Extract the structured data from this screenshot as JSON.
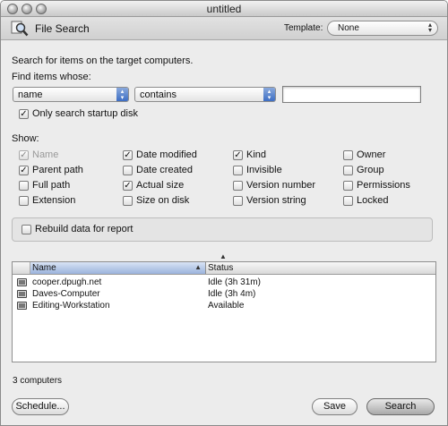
{
  "window": {
    "title": "untitled"
  },
  "toolbar": {
    "title": "File Search",
    "template_label": "Template:",
    "template_value": "None"
  },
  "search": {
    "intro": "Search for items on the target computers.",
    "find_label": "Find items whose:",
    "attribute": "name",
    "operator": "contains",
    "query": "",
    "startup_disk": {
      "label": "Only search startup disk",
      "checked": true
    }
  },
  "show": {
    "label": "Show:",
    "columns": [
      [
        {
          "label": "Name",
          "checked": true,
          "disabled": true
        },
        {
          "label": "Parent path",
          "checked": true
        },
        {
          "label": "Full path",
          "checked": false
        },
        {
          "label": "Extension",
          "checked": false
        }
      ],
      [
        {
          "label": "Date modified",
          "checked": true
        },
        {
          "label": "Date created",
          "checked": false
        },
        {
          "label": "Actual size",
          "checked": true
        },
        {
          "label": "Size on disk",
          "checked": false
        }
      ],
      [
        {
          "label": "Kind",
          "checked": true
        },
        {
          "label": "Invisible",
          "checked": false
        },
        {
          "label": "Version number",
          "checked": false
        },
        {
          "label": "Version string",
          "checked": false
        }
      ],
      [
        {
          "label": "Owner",
          "checked": false
        },
        {
          "label": "Group",
          "checked": false
        },
        {
          "label": "Permissions",
          "checked": false
        },
        {
          "label": "Locked",
          "checked": false
        }
      ]
    ]
  },
  "rebuild": {
    "label": "Rebuild data for report",
    "checked": false
  },
  "table": {
    "columns": [
      "Name",
      "Status"
    ],
    "rows": [
      {
        "name": "cooper.dpugh.net",
        "status": "Idle (3h 31m)"
      },
      {
        "name": "Daves-Computer",
        "status": "Idle (3h 4m)"
      },
      {
        "name": "Editing-Workstation",
        "status": "Available"
      }
    ]
  },
  "footer": {
    "count": "3 computers",
    "schedule_label": "Schedule...",
    "save_label": "Save",
    "search_label": "Search"
  }
}
